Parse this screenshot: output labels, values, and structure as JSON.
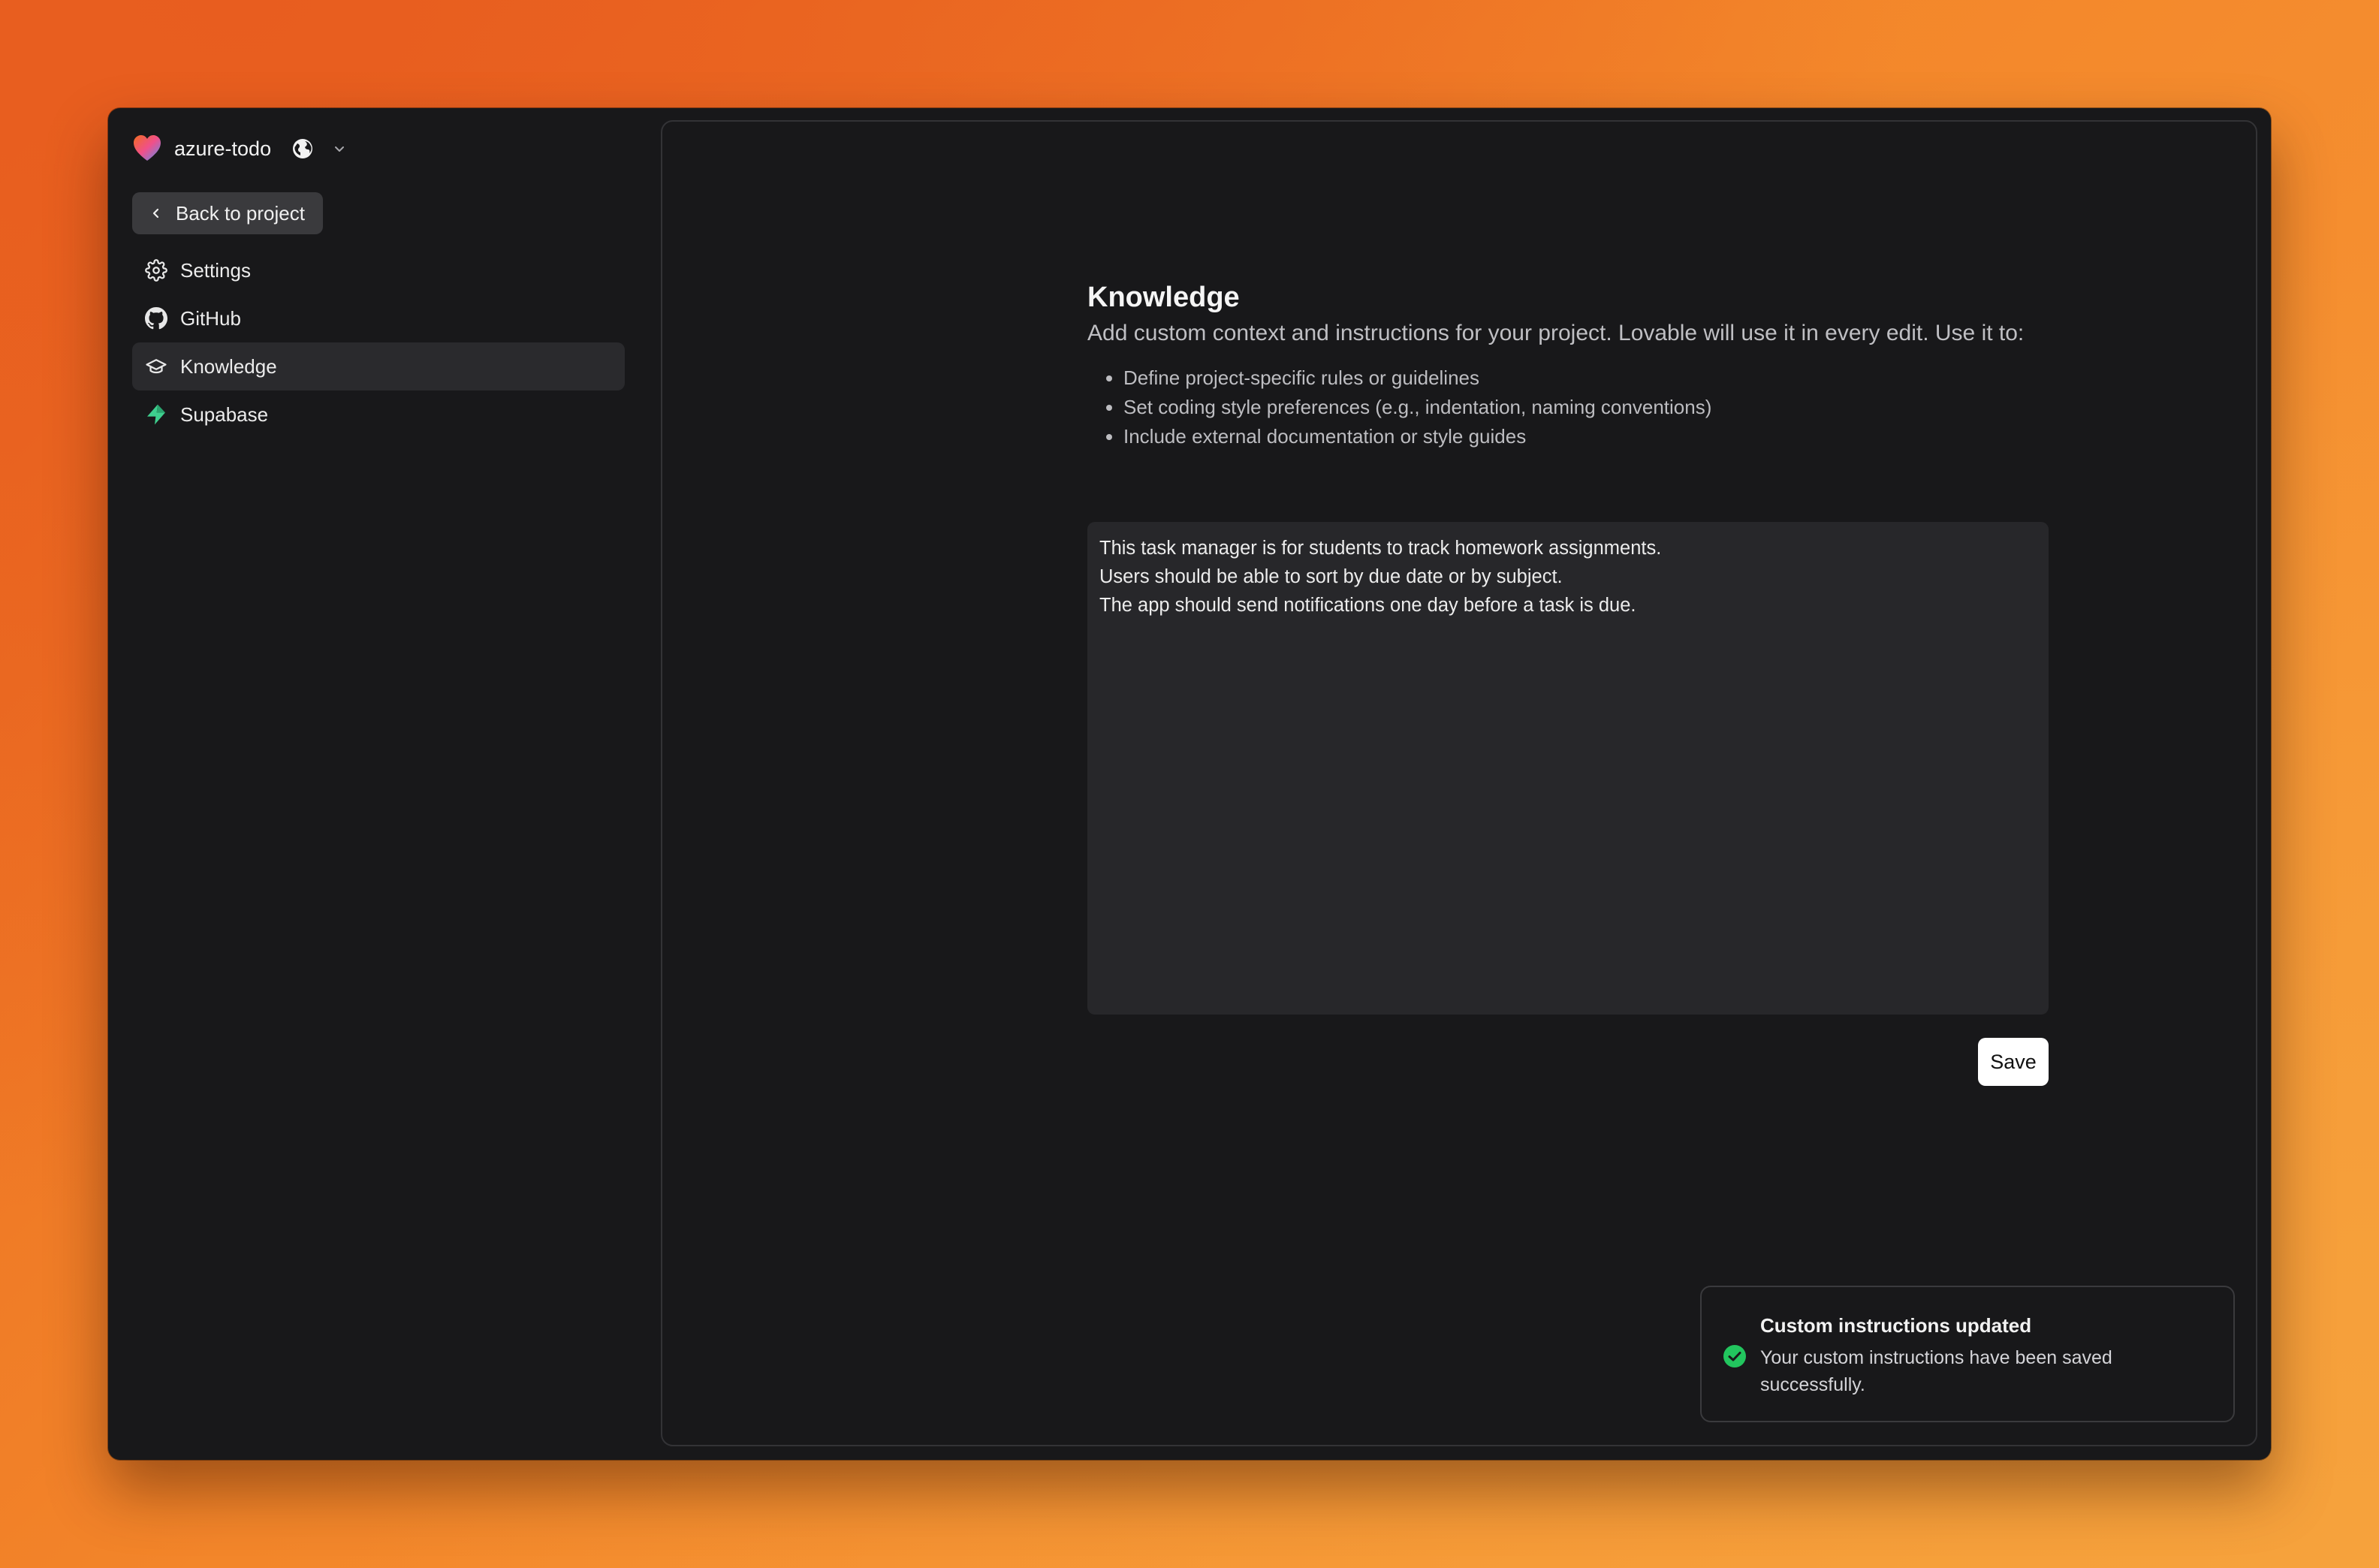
{
  "project": {
    "name": "azure-todo",
    "logo_icon": "lovable-heart-icon",
    "visibility_icon": "globe-icon",
    "menu_icon": "chevron-down-icon"
  },
  "sidebar": {
    "back_label": "Back to project",
    "items": [
      {
        "label": "Settings",
        "icon": "gear-icon",
        "active": false
      },
      {
        "label": "GitHub",
        "icon": "github-icon",
        "active": false
      },
      {
        "label": "Knowledge",
        "icon": "graduation-cap-icon",
        "active": true
      },
      {
        "label": "Supabase",
        "icon": "supabase-icon",
        "active": false
      }
    ]
  },
  "knowledge": {
    "title": "Knowledge",
    "description": "Add custom context and instructions for your project. Lovable will use it in every edit. Use it to:",
    "bullets": [
      "Define project-specific rules or guidelines",
      "Set coding style preferences (e.g., indentation, naming conventions)",
      "Include external documentation or style guides"
    ],
    "textarea_value": "This task manager is for students to track homework assignments.\nUsers should be able to sort by due date or by subject.\nThe app should send notifications one day before a task is due.",
    "save_label": "Save"
  },
  "toast": {
    "title": "Custom instructions updated",
    "message": "Your custom instructions have been saved successfully.",
    "icon": "check-circle-icon"
  },
  "colors": {
    "background_gradient_start": "#e8621e",
    "background_gradient_end": "#f89b38",
    "window_bg": "#18181a",
    "active_nav_bg": "#2a2a2d",
    "success_green": "#22c55e",
    "supabase_green": "#3ecf8e"
  }
}
